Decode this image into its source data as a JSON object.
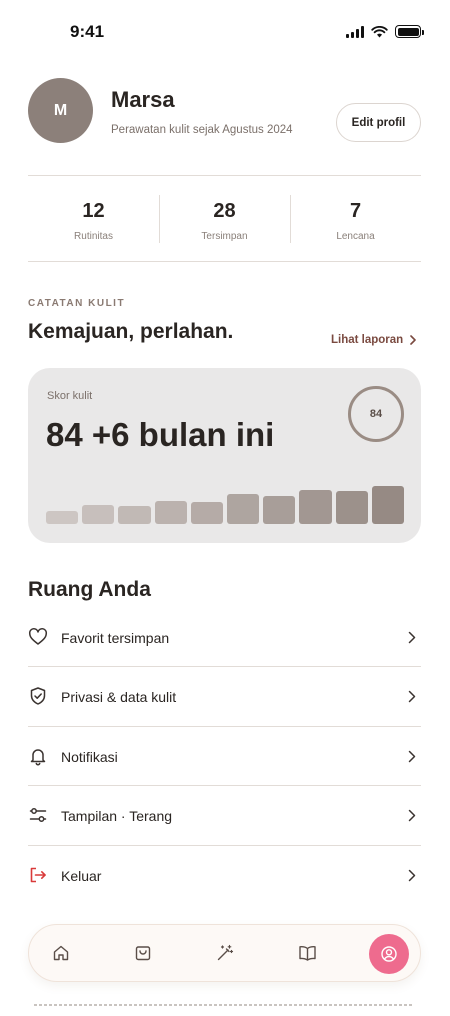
{
  "status_bar": {
    "time": "9:41"
  },
  "profile": {
    "avatar_initial": "M",
    "name": "Marsa",
    "subtitle": "Perawatan kulit sejak Agustus 2024",
    "edit_label": "Edit profil"
  },
  "stats": [
    {
      "value": "12",
      "label": "Rutinitas"
    },
    {
      "value": "28",
      "label": "Tersimpan"
    },
    {
      "value": "7",
      "label": "Lencana"
    }
  ],
  "skin_notes": {
    "eyebrow": "CATATAN KULIT",
    "title": "Kemajuan, perlahan.",
    "report_link": "Lihat laporan",
    "card": {
      "label": "Skor kulit",
      "score_text": "84 +6 bulan ini",
      "ring_value": "84",
      "bar_levels": [
        0.32,
        0.48,
        0.45,
        0.58,
        0.56,
        0.76,
        0.7,
        0.86,
        0.82,
        0.96
      ]
    }
  },
  "your_space": {
    "title": "Ruang Anda",
    "items": [
      {
        "label": "Favorit tersimpan",
        "icon": "heart-icon"
      },
      {
        "label": "Privasi & data kulit",
        "icon": "shield-check-icon"
      },
      {
        "label": "Notifikasi",
        "icon": "bell-icon"
      },
      {
        "label": "Tampilan · Terang",
        "icon": "sliders-icon"
      },
      {
        "label": "Keluar",
        "icon": "logout-icon"
      }
    ]
  },
  "bottom_nav": {
    "items": [
      "home-icon",
      "shopping-bag-icon",
      "magic-wand-icon",
      "book-icon",
      "profile-icon"
    ],
    "active": "profile-icon"
  },
  "colors": {
    "accent_pink": "#ee6b8e",
    "avatar": "#8c807a",
    "card_bg": "#e9e8e8",
    "link": "#7a4a40",
    "logout_red": "#d93a3a"
  }
}
